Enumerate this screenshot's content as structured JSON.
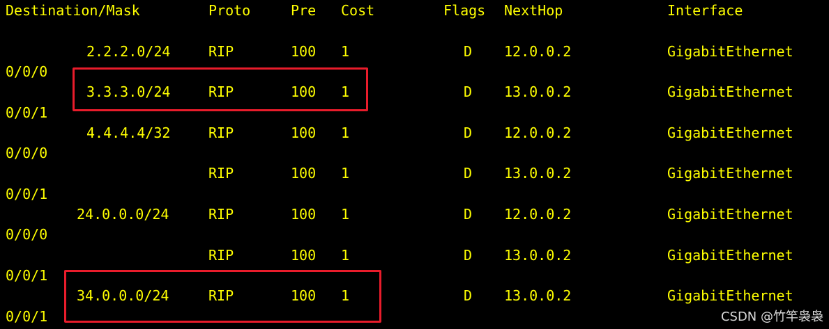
{
  "colors": {
    "background": "#000000",
    "text": "#ffff00",
    "highlight": "#e81c2b",
    "watermark": "#ffffff"
  },
  "header": {
    "destination": "Destination/Mask",
    "proto": "Proto",
    "pre": "Pre",
    "cost": "Cost",
    "flags": "Flags",
    "nexthop": "NextHop",
    "interface": "Interface"
  },
  "routes": [
    {
      "destination": "2.2.2.0/24",
      "proto": "RIP",
      "pre": "100",
      "cost": "1",
      "flags": "D",
      "nexthop": "12.0.0.2",
      "interface": "GigabitEthernet",
      "interface_cont": "0/0/0"
    },
    {
      "destination": "3.3.3.0/24",
      "proto": "RIP",
      "pre": "100",
      "cost": "1",
      "flags": "D",
      "nexthop": "13.0.0.2",
      "interface": "GigabitEthernet",
      "interface_cont": "0/0/1"
    },
    {
      "destination": "4.4.4.4/32",
      "proto": "RIP",
      "pre": "100",
      "cost": "1",
      "flags": "D",
      "nexthop": "12.0.0.2",
      "interface": "GigabitEthernet",
      "interface_cont": "0/0/0"
    },
    {
      "destination": "",
      "proto": "RIP",
      "pre": "100",
      "cost": "1",
      "flags": "D",
      "nexthop": "13.0.0.2",
      "interface": "GigabitEthernet",
      "interface_cont": "0/0/1"
    },
    {
      "destination": "24.0.0.0/24",
      "proto": "RIP",
      "pre": "100",
      "cost": "1",
      "flags": "D",
      "nexthop": "12.0.0.2",
      "interface": "GigabitEthernet",
      "interface_cont": "0/0/0"
    },
    {
      "destination": "",
      "proto": "RIP",
      "pre": "100",
      "cost": "1",
      "flags": "D",
      "nexthop": "13.0.0.2",
      "interface": "GigabitEthernet",
      "interface_cont": "0/0/1"
    },
    {
      "destination": "34.0.0.0/24",
      "proto": "RIP",
      "pre": "100",
      "cost": "1",
      "flags": "D",
      "nexthop": "13.0.0.2",
      "interface": "GigabitEthernet",
      "interface_cont": "0/0/1"
    }
  ],
  "watermark": "CSDN @竹竿袅袅"
}
